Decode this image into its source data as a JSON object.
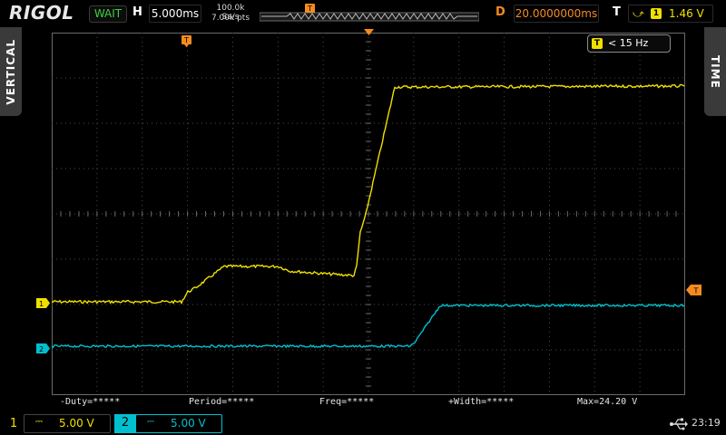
{
  "header": {
    "brand": "RIGOL",
    "run_state": "WAIT",
    "horizontal_letter": "H",
    "timebase": "5.000ms",
    "sample_rate": "100.0k Sa/s",
    "memory_depth": "7.00k pts",
    "delay_letter": "D",
    "delay": "20.0000000ms",
    "trigger_letter": "T",
    "trigger_channel": "1",
    "trigger_level": "1.46 V"
  },
  "side_tabs": {
    "left": "VERTICAL",
    "right": "TIME"
  },
  "frequency_counter": {
    "channel": "T",
    "value": "< 15 Hz"
  },
  "measurements": [
    "-Duty=*****",
    "Period=*****",
    "Freq=*****",
    "+Width=*****",
    "Max=24.20 V"
  ],
  "channels": [
    {
      "number": "1",
      "coupling": "⎓",
      "scale": "5.00 V",
      "color": "#f0e000"
    },
    {
      "number": "2",
      "coupling": "⎓",
      "scale": "5.00 V",
      "color": "#00c0d0"
    }
  ],
  "markers": {
    "ch1": "1",
    "ch2": "2",
    "trigger": "T"
  },
  "status": {
    "usb_icon": "usb-icon",
    "time": "23:19"
  },
  "colors": {
    "ch1": "#f0e000",
    "ch2": "#00c0d0",
    "trigger": "#f58b1e",
    "grid": "#4a4a4a"
  }
}
